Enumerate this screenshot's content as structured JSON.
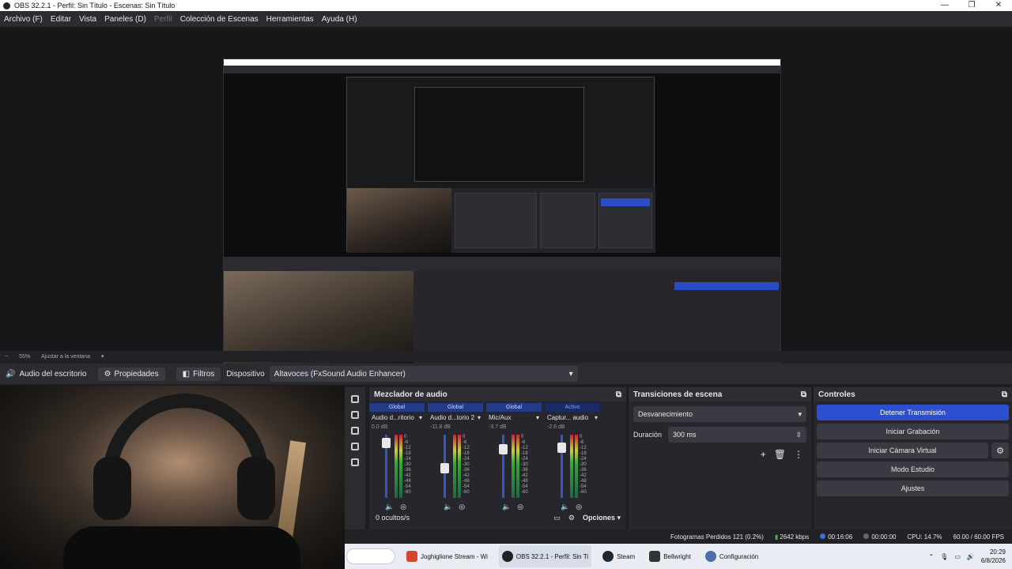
{
  "window": {
    "title": "OBS 32.2.1 - Perfil: Sin Título - Escenas: Sin Título",
    "controls": [
      "—",
      "❐",
      "✕"
    ]
  },
  "menu": {
    "items": [
      "Archivo (F)",
      "Editar",
      "Vista",
      "Paneles (D)",
      "Perfil",
      "Colección de Escenas",
      "Herramientas",
      "Ayuda (H)"
    ]
  },
  "zoom": {
    "level": "55%",
    "fit": "Ajustar a la ventana"
  },
  "source_bar": {
    "source_name": "Audio del escritorio",
    "properties": "Propiedades",
    "filters": "Filtros",
    "device_label": "Dispositivo",
    "device_value": "Altavoces (FxSound Audio Enhancer)"
  },
  "mixer": {
    "title": "Mezclador de audio",
    "channels": [
      {
        "tag": "Global",
        "name": "Audio d...ritorio",
        "db": "0.0 dB",
        "fader": 0.95
      },
      {
        "tag": "Global",
        "name": "Audio d...torio 2",
        "db": "-11.8 dB",
        "fader": 0.55
      },
      {
        "tag": "Global",
        "name": "Mic/Aux",
        "db": "-3.7 dB",
        "fader": 0.85
      },
      {
        "tag": "Activo",
        "name": "Captur... audio",
        "db": "-2.6 dB",
        "fader": 0.88
      }
    ],
    "scale": [
      "0",
      "-6",
      "-12",
      "-18",
      "-24",
      "-30",
      "-36",
      "-42",
      "-48",
      "-54",
      "-60"
    ],
    "hidden": "0 ocultos/s",
    "options": "Opciones"
  },
  "transitions": {
    "title": "Transiciones de escena",
    "selected": "Desvanecimiento",
    "duration_label": "Duración",
    "duration_value": "300 ms"
  },
  "controls": {
    "title": "Controles",
    "stop_stream": "Detener Transmisión",
    "start_recording": "Iniciar Grabación",
    "start_virtualcam": "Iniciar Cámara Virtual",
    "studio_mode": "Modo Estudio",
    "settings": "Ajustes"
  },
  "status": {
    "dropped_frames": "Fotogramas Perdidos 121 (0.2%)",
    "bitrate": "2642 kbps",
    "stream_time": "00:16:06",
    "rec_time": "00:00:00",
    "cpu": "CPU: 14.7%",
    "fps": "60.00 / 60.00 FPS"
  },
  "taskbar": {
    "tasks": [
      {
        "label": "Joghiglione Stream - Wi",
        "color": "#d4472f"
      },
      {
        "label": "OBS 32.2.1 - Perfil: Sin Ti",
        "color": "#222222"
      },
      {
        "label": "Steam",
        "color": "#1b2838"
      },
      {
        "label": "Bellwright",
        "color": "#333333"
      },
      {
        "label": "Configuración",
        "color": "#4a6ea9"
      }
    ],
    "time": "20:29",
    "date": "6/8/2026"
  },
  "colors": {
    "accent": "#2c4fd0",
    "bg": "#26262c",
    "panel": "#2d2d33"
  }
}
